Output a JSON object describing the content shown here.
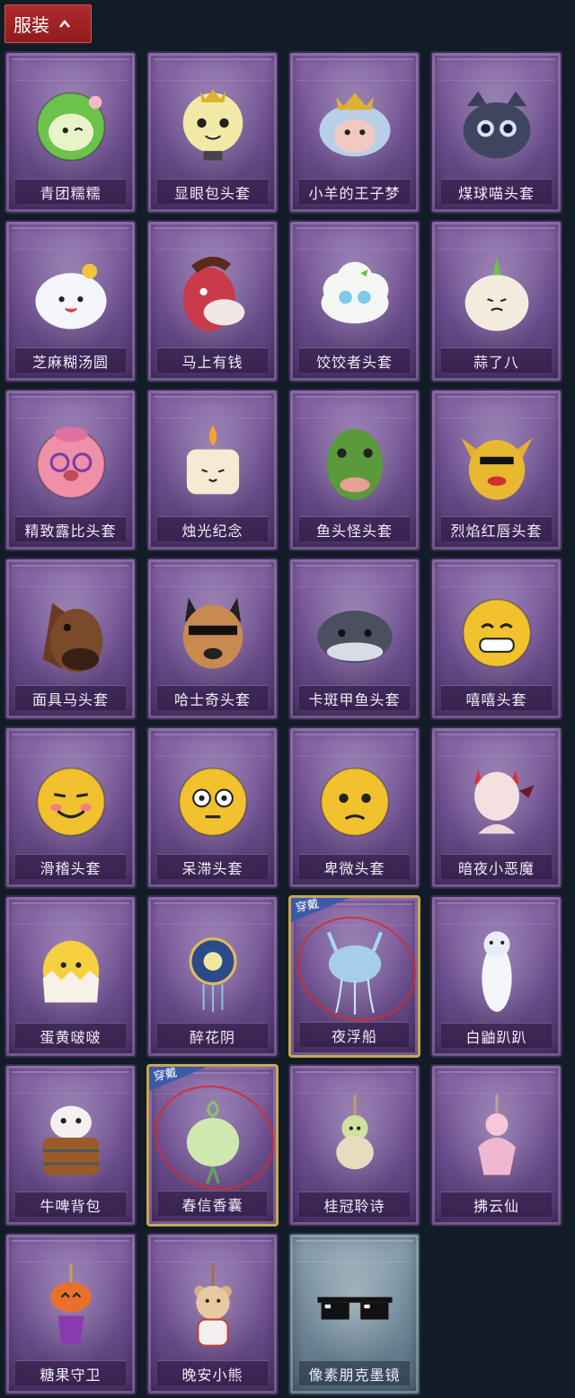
{
  "header": {
    "tab_label": "服装"
  },
  "equipped_badge": "穿戴",
  "items": [
    {
      "label": "青团糯糯",
      "icon": "green-rice-ball-icon",
      "style": "purple",
      "equipped": false
    },
    {
      "label": "显眼包头套",
      "icon": "lightbulb-head-icon",
      "style": "purple",
      "equipped": false
    },
    {
      "label": "小羊的王子梦",
      "icon": "crowned-sheep-icon",
      "style": "purple",
      "equipped": false
    },
    {
      "label": "煤球喵头套",
      "icon": "black-cat-head-icon",
      "style": "purple",
      "equipped": false
    },
    {
      "label": "芝麻糊汤圆",
      "icon": "dumpling-icon",
      "style": "purple",
      "equipped": false
    },
    {
      "label": "马上有钱",
      "icon": "red-horse-head-icon",
      "style": "purple",
      "equipped": false
    },
    {
      "label": "饺饺者头套",
      "icon": "cloud-dumpling-head-icon",
      "style": "purple",
      "equipped": false
    },
    {
      "label": "蒜了八",
      "icon": "garlic-head-icon",
      "style": "purple",
      "equipped": false
    },
    {
      "label": "精致露比头套",
      "icon": "pink-beaver-head-icon",
      "style": "purple",
      "equipped": false
    },
    {
      "label": "烛光纪念",
      "icon": "candle-head-icon",
      "style": "purple",
      "equipped": false
    },
    {
      "label": "鱼头怪头套",
      "icon": "fish-head-icon",
      "style": "purple",
      "equipped": false
    },
    {
      "label": "烈焰红唇头套",
      "icon": "yellow-mouse-head-icon",
      "style": "purple",
      "equipped": false
    },
    {
      "label": "面具马头套",
      "icon": "horse-mask-icon",
      "style": "purple",
      "equipped": false
    },
    {
      "label": "哈士奇头套",
      "icon": "husky-head-icon",
      "style": "purple",
      "equipped": false
    },
    {
      "label": "卡斑甲鱼头套",
      "icon": "whale-head-icon",
      "style": "purple",
      "equipped": false
    },
    {
      "label": "嘻嘻头套",
      "icon": "grin-emoji-icon",
      "style": "purple",
      "equipped": false
    },
    {
      "label": "滑稽头套",
      "icon": "funny-emoji-icon",
      "style": "purple",
      "equipped": false
    },
    {
      "label": "呆滞头套",
      "icon": "dazed-emoji-icon",
      "style": "purple",
      "equipped": false
    },
    {
      "label": "卑微头套",
      "icon": "humble-emoji-icon",
      "style": "purple",
      "equipped": false
    },
    {
      "label": "暗夜小恶魔",
      "icon": "little-devil-icon",
      "style": "purple",
      "equipped": false
    },
    {
      "label": "蛋黄啵啵",
      "icon": "egg-chick-icon",
      "style": "purple",
      "equipped": false
    },
    {
      "label": "醉花阴",
      "icon": "flower-ornament-icon",
      "style": "purple",
      "equipped": false
    },
    {
      "label": "夜浮船",
      "icon": "jellyfish-icon",
      "style": "purple",
      "equipped": true
    },
    {
      "label": "白鼬趴趴",
      "icon": "white-ferret-icon",
      "style": "purple",
      "equipped": false
    },
    {
      "label": "牛啤背包",
      "icon": "cow-barrel-icon",
      "style": "purple",
      "equipped": false
    },
    {
      "label": "春信香囊",
      "icon": "sachet-icon",
      "style": "purple",
      "equipped": true
    },
    {
      "label": "桂冠聆诗",
      "icon": "fairy-charm-icon",
      "style": "purple",
      "equipped": false
    },
    {
      "label": "拂云仙",
      "icon": "pink-fairy-charm-icon",
      "style": "purple",
      "equipped": false
    },
    {
      "label": "糖果守卫",
      "icon": "pumpkin-charm-icon",
      "style": "purple",
      "equipped": false
    },
    {
      "label": "晚安小熊",
      "icon": "bear-charm-icon",
      "style": "purple",
      "equipped": false
    },
    {
      "label": "像素朋克墨镜",
      "icon": "pixel-sunglasses-icon",
      "style": "blue",
      "equipped": false
    }
  ],
  "colors": {
    "background": "#121c26",
    "tab_red": "#a52424",
    "card_purple": "#7b5c9b",
    "card_blue": "#7c93a2",
    "equipped_gold": "#c9a55a",
    "badge_blue": "#3d5aa8"
  }
}
